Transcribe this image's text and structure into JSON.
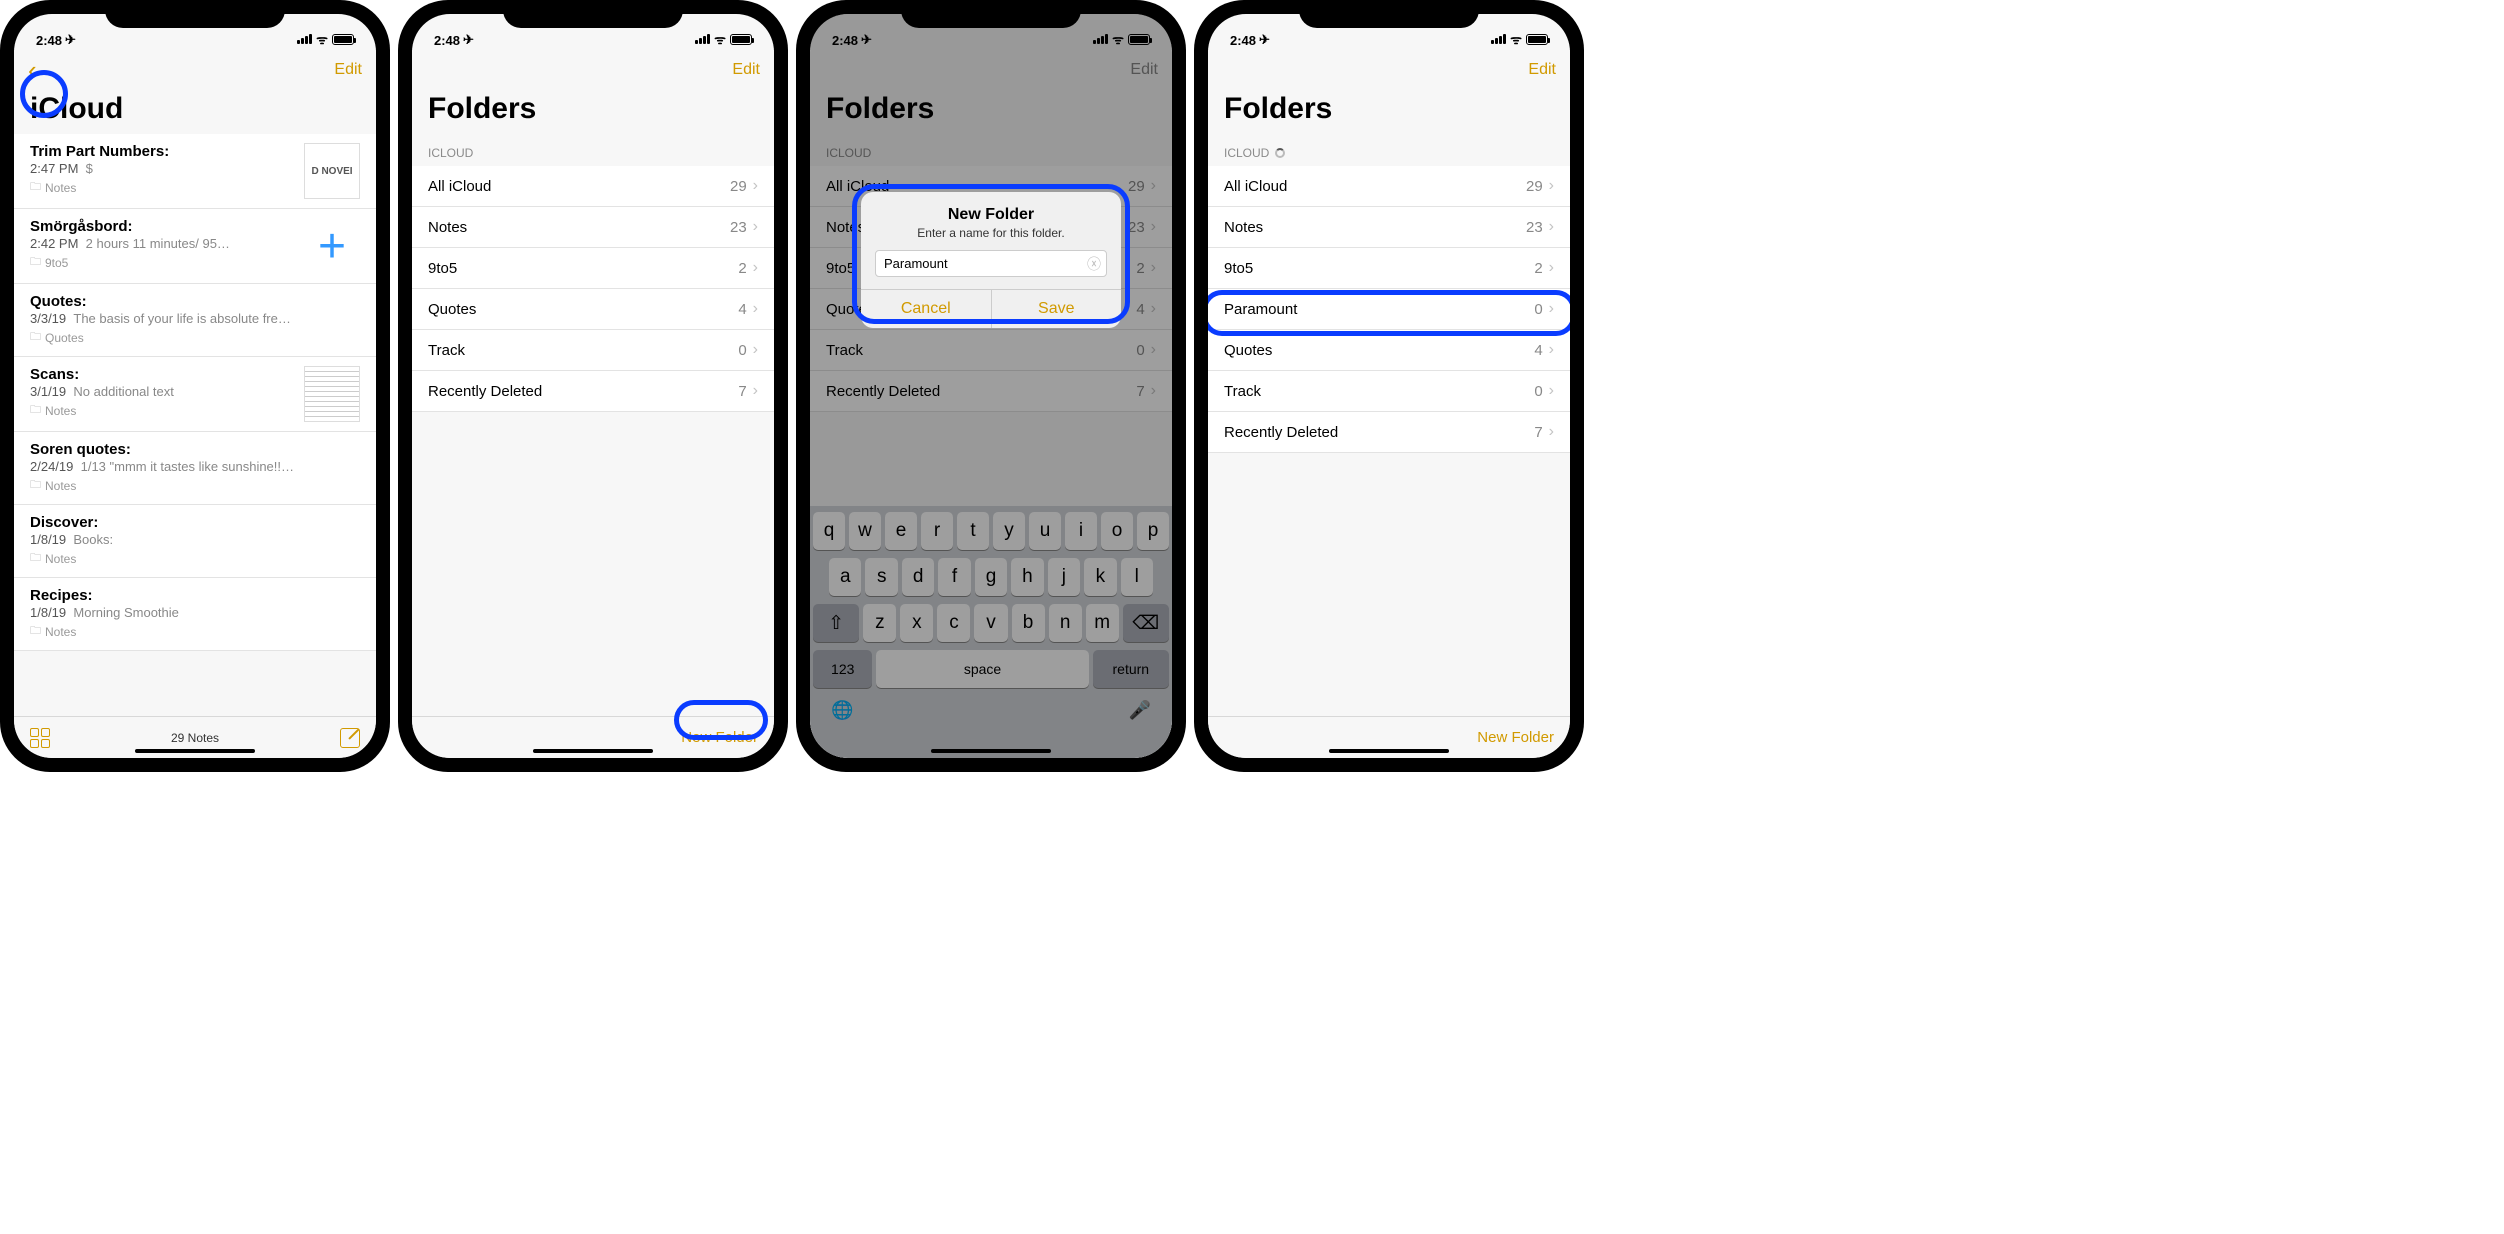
{
  "status": {
    "time": "2:48",
    "loc_arrow": "➤"
  },
  "colors": {
    "accent": "#d19a00",
    "highlight": "#0a3cff"
  },
  "screen1": {
    "nav_edit": "Edit",
    "title": "iCloud",
    "notes": [
      {
        "title": "Trim Part Numbers:",
        "time": "2:47 PM",
        "preview": "$",
        "folder": "Notes",
        "thumb": "novel"
      },
      {
        "title": "Smörgåsbord:",
        "time": "2:42 PM",
        "preview": "2 hours 11 minutes/ 95…",
        "folder": "9to5",
        "thumb": "plus"
      },
      {
        "title": "Quotes:",
        "time": "3/3/19",
        "preview": "The basis of your life is absolute fre…",
        "folder": "Quotes"
      },
      {
        "title": "Scans:",
        "time": "3/1/19",
        "preview": "No additional text",
        "folder": "Notes",
        "thumb": "doc"
      },
      {
        "title": "Soren quotes:",
        "time": "2/24/19",
        "preview": "1/13 \"mmm it tastes like sunshine!!…",
        "folder": "Notes"
      },
      {
        "title": "Discover:",
        "time": "1/8/19",
        "preview": "Books:",
        "folder": "Notes"
      },
      {
        "title": "Recipes:",
        "time": "1/8/19",
        "preview": "Morning Smoothie",
        "folder": "Notes"
      }
    ],
    "footer_count": "29 Notes"
  },
  "screen2": {
    "title": "Folders",
    "section": "ICLOUD",
    "folders": [
      {
        "name": "All iCloud",
        "count": 29
      },
      {
        "name": "Notes",
        "count": 23
      },
      {
        "name": "9to5",
        "count": 2
      },
      {
        "name": "Quotes",
        "count": 4
      },
      {
        "name": "Track",
        "count": 0
      },
      {
        "name": "Recently Deleted",
        "count": 7
      }
    ],
    "new_folder": "New Folder"
  },
  "screen3": {
    "title": "Folders",
    "section": "ICLOUD",
    "dialog": {
      "title": "New Folder",
      "message": "Enter a name for this folder.",
      "input_value": "Paramount",
      "cancel": "Cancel",
      "save": "Save"
    },
    "keyboard": {
      "rows": [
        [
          "q",
          "w",
          "e",
          "r",
          "t",
          "y",
          "u",
          "i",
          "o",
          "p"
        ],
        [
          "a",
          "s",
          "d",
          "f",
          "g",
          "h",
          "j",
          "k",
          "l"
        ],
        [
          "⇧",
          "z",
          "x",
          "c",
          "v",
          "b",
          "n",
          "m",
          "⌫"
        ]
      ],
      "num": "123",
      "space": "space",
      "return": "return"
    }
  },
  "screen4": {
    "nav_edit": "Edit",
    "title": "Folders",
    "section": "ICLOUD",
    "folders": [
      {
        "name": "All iCloud",
        "count": 29
      },
      {
        "name": "Notes",
        "count": 23
      },
      {
        "name": "9to5",
        "count": 2
      },
      {
        "name": "Paramount",
        "count": 0,
        "highlight": true
      },
      {
        "name": "Quotes",
        "count": 4
      },
      {
        "name": "Track",
        "count": 0
      },
      {
        "name": "Recently Deleted",
        "count": 7
      }
    ],
    "new_folder": "New Folder"
  }
}
